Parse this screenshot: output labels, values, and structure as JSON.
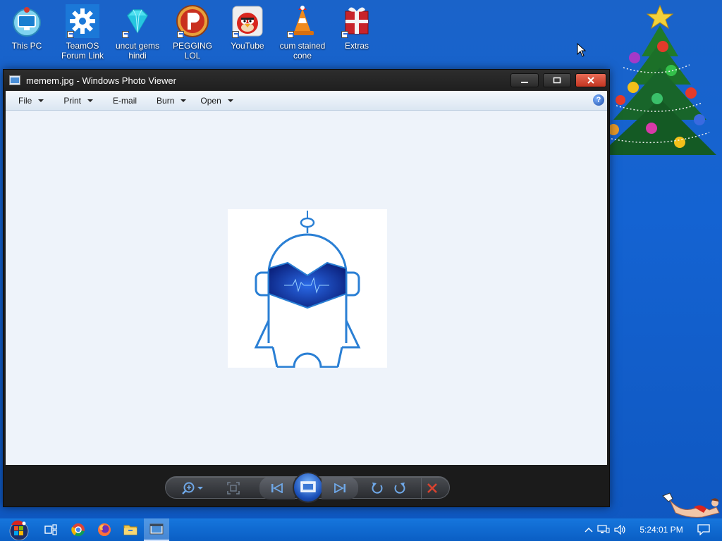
{
  "desktop": {
    "icons": [
      {
        "label": "This PC"
      },
      {
        "label": "TeamOS Forum Link"
      },
      {
        "label": "uncut gems hindi"
      },
      {
        "label": "PEGGING LOL"
      },
      {
        "label": "YouTube"
      },
      {
        "label": "cum stained cone"
      },
      {
        "label": "Extras"
      }
    ]
  },
  "window": {
    "title": "memem.jpg - Windows Photo Viewer",
    "buttons": {
      "minimize": "minimize",
      "maximize": "maximize",
      "close": "close"
    }
  },
  "menubar": {
    "items": [
      {
        "label": "File",
        "has_dropdown": true
      },
      {
        "label": "Print",
        "has_dropdown": true
      },
      {
        "label": "E-mail",
        "has_dropdown": false
      },
      {
        "label": "Burn",
        "has_dropdown": true
      },
      {
        "label": "Open",
        "has_dropdown": true
      }
    ],
    "help": "?"
  },
  "controls": {
    "icons": [
      "zoom-icon",
      "actual-size-icon",
      "previous-icon",
      "slideshow-icon",
      "next-icon",
      "rotate-counterclockwise-icon",
      "rotate-clockwise-icon",
      "delete-icon"
    ]
  },
  "taskbar": {
    "clock": "5:24:01 PM",
    "apps": [
      "start-button",
      "task-view-icon",
      "chrome-icon",
      "firefox-icon",
      "file-explorer-icon",
      "photo-viewer-icon"
    ]
  },
  "colors": {
    "desktop": "#1463d2",
    "close_button": "#d9432f",
    "accent_blue": "#2a7fd4",
    "taskbar": "#0f6ad8"
  }
}
